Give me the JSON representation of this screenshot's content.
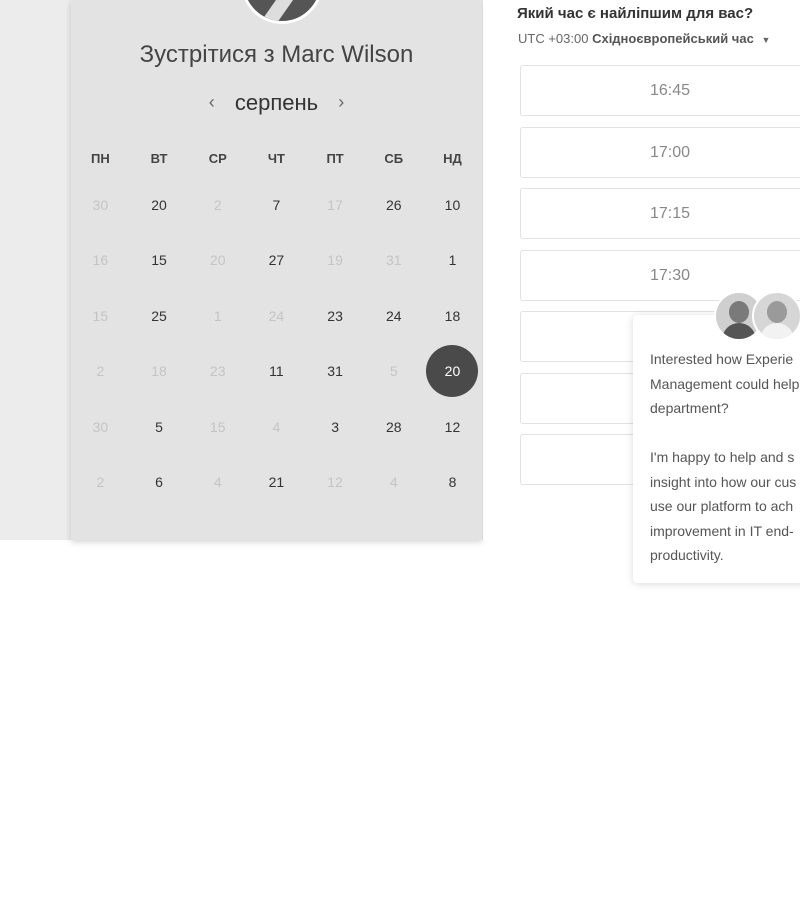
{
  "left": {
    "title": "Зустрітися з Marc Wilson",
    "month": "серпень",
    "prev_icon": "‹",
    "next_icon": "›"
  },
  "calendar": {
    "weekdays": [
      "ПН",
      "ВТ",
      "СР",
      "ЧТ",
      "ПТ",
      "СБ",
      "НД"
    ],
    "weeks": [
      [
        {
          "d": "30",
          "dim": true
        },
        {
          "d": "20"
        },
        {
          "d": "2",
          "dim": true
        },
        {
          "d": "7"
        },
        {
          "d": "17",
          "dim": true
        },
        {
          "d": "26"
        },
        {
          "d": "10"
        }
      ],
      [
        {
          "d": "16",
          "dim": true
        },
        {
          "d": "15"
        },
        {
          "d": "20",
          "dim": true
        },
        {
          "d": "27"
        },
        {
          "d": "19",
          "dim": true
        },
        {
          "d": "31",
          "dim": true
        },
        {
          "d": "1"
        }
      ],
      [
        {
          "d": "15",
          "dim": true
        },
        {
          "d": "25"
        },
        {
          "d": "1",
          "dim": true
        },
        {
          "d": "24",
          "dim": true
        },
        {
          "d": "23"
        },
        {
          "d": "24"
        },
        {
          "d": "18"
        }
      ],
      [
        {
          "d": "2",
          "dim": true
        },
        {
          "d": "18",
          "dim": true
        },
        {
          "d": "23",
          "dim": true
        },
        {
          "d": "11"
        },
        {
          "d": "31"
        },
        {
          "d": "5",
          "dim": true
        },
        {
          "d": "20",
          "selected": true
        }
      ],
      [
        {
          "d": "30",
          "dim": true
        },
        {
          "d": "5"
        },
        {
          "d": "15",
          "dim": true
        },
        {
          "d": "4",
          "dim": true
        },
        {
          "d": "3"
        },
        {
          "d": "28"
        },
        {
          "d": "12"
        }
      ],
      [
        {
          "d": "2",
          "dim": true
        },
        {
          "d": "6"
        },
        {
          "d": "4",
          "dim": true
        },
        {
          "d": "21"
        },
        {
          "d": "12",
          "dim": true
        },
        {
          "d": "4",
          "dim": true
        },
        {
          "d": "8"
        }
      ]
    ]
  },
  "right": {
    "question": "Який час є найліпшим для вас?",
    "tz_prefix": "UTC +03:00",
    "tz_name": "Східноєвропейський час",
    "tz_caret": "▼",
    "slots": [
      "16:45",
      "17:00",
      "17:15",
      "17:30",
      "",
      "",
      "",
      ""
    ]
  },
  "chat": {
    "message": "Interested how Experie\nManagement could help\ndepartment?\n\nI'm happy to help and s\ninsight into how our cus\nuse our platform to ach\nimprovement in IT end-\nproductivity."
  }
}
